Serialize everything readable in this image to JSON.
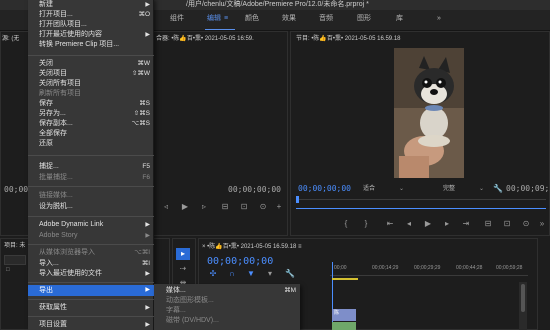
{
  "title_bar": {
    "text": "/用户/chenlu/文稿/Adobe/Premiere Pro/12.0/未命名.prproj *"
  },
  "workspaces": [
    {
      "label": "组件"
    },
    {
      "label": "编辑",
      "active": true
    },
    {
      "label": "颜色"
    },
    {
      "label": "效果"
    },
    {
      "label": "音频"
    },
    {
      "label": "图形"
    },
    {
      "label": "库"
    }
  ],
  "workspace_more": "»",
  "source_panel": {
    "title_left": "源: (无",
    "title_right": "合器: •陈👍百•熏• 2021-05-05 16:59.",
    "tc_left": "00;00",
    "tc_right": "00;00;00;00"
  },
  "program_panel": {
    "title": "节目: •陈👍百•熏• 2021-05-05 16.59.18",
    "tc_current": "00;00;00;00",
    "fit_label": "适合",
    "quality_label": "完整",
    "tc_end": "00;00;09;2"
  },
  "project_panel": {
    "title": "项目: 未",
    "search_placeholder": ""
  },
  "timeline": {
    "title": "•陈👍百•熏• 2021-05-05 16.59.18",
    "tc": "00;00;00;00",
    "ruler": [
      "00;00",
      "00;00;14;29",
      "00;00;29;29",
      "00;00;44;28",
      "00;00;59;28"
    ],
    "clip_label": "陈"
  },
  "file_menu": {
    "items": [
      {
        "label": "新建",
        "shortcut": "",
        "submenu": true
      },
      {
        "label": "打开项目...",
        "shortcut": "⌘O"
      },
      {
        "label": "打开团队项目..."
      },
      {
        "label": "打开最近使用的内容",
        "submenu": true
      },
      {
        "label": "转换 Premiere Clip 项目..."
      },
      {
        "label": "关闭",
        "shortcut": "⌘W"
      },
      {
        "label": "关闭项目",
        "shortcut": "⇧⌘W"
      },
      {
        "label": "关闭所有项目"
      },
      {
        "label": "刷新所有项目",
        "disabled": true
      },
      {
        "label": "保存",
        "shortcut": "⌘S"
      },
      {
        "label": "另存为...",
        "shortcut": "⇧⌘S"
      },
      {
        "label": "保存副本...",
        "shortcut": "⌥⌘S"
      },
      {
        "label": "全部保存"
      },
      {
        "label": "还原"
      },
      {
        "label": "捕捉...",
        "shortcut": "F5"
      },
      {
        "label": "批量捕捉...",
        "shortcut": "F6",
        "disabled": true
      },
      {
        "label": "链接媒体...",
        "disabled": true
      },
      {
        "label": "设为脱机..."
      },
      {
        "label": "Adobe Dynamic Link",
        "submenu": true
      },
      {
        "label": "Adobe Story",
        "submenu": true,
        "disabled": true
      },
      {
        "label": "从媒体浏览器导入",
        "shortcut": "⌥⌘I",
        "disabled": true
      },
      {
        "label": "导入...",
        "shortcut": "⌘I"
      },
      {
        "label": "导入最近使用的文件",
        "submenu": true
      },
      {
        "label": "导出",
        "submenu": true,
        "highlighted": true
      },
      {
        "label": "获取属性",
        "submenu": true
      },
      {
        "label": "项目设置",
        "submenu": true
      }
    ]
  },
  "export_submenu": {
    "items": [
      {
        "label": "媒体...",
        "shortcut": "⌘M"
      },
      {
        "label": "动态图形模板...",
        "disabled": true
      },
      {
        "label": "字幕...",
        "disabled": true
      },
      {
        "label": "磁带 (DV/HDV)...",
        "disabled": true
      }
    ]
  },
  "colors": {
    "accent": "#2a6bd6",
    "timecode": "#4b8eff",
    "clip": "#7e8ec9"
  }
}
